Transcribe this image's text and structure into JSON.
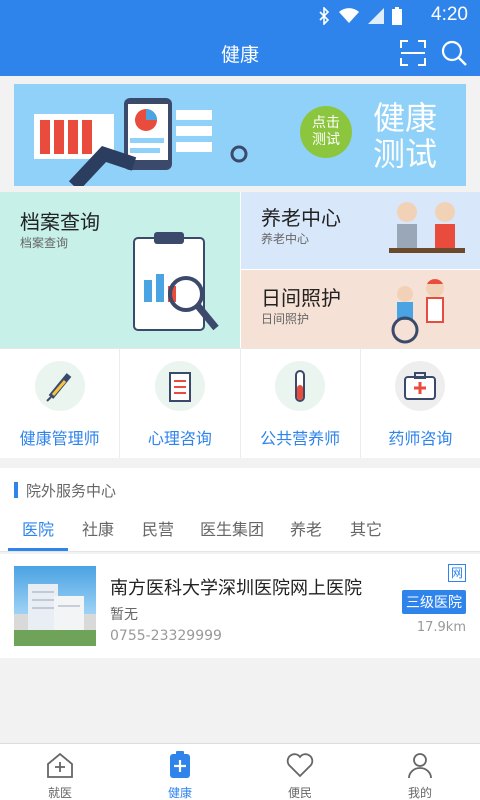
{
  "status_bar": {
    "time": "4:20"
  },
  "header": {
    "title": "健康"
  },
  "banner": {
    "title": "健康测试",
    "button": "点击测试"
  },
  "tiles": {
    "records": {
      "title": "档案查询",
      "subtitle": "档案查询"
    },
    "elderly": {
      "title": "养老中心",
      "subtitle": "养老中心"
    },
    "daycare": {
      "title": "日间照护",
      "subtitle": "日间照护"
    }
  },
  "services": [
    {
      "label": "健康管理师",
      "icon": "syringe-icon"
    },
    {
      "label": "心理咨询",
      "icon": "clipboard-icon"
    },
    {
      "label": "公共营养师",
      "icon": "test-tube-icon"
    },
    {
      "label": "药师咨询",
      "icon": "medical-kit-icon"
    }
  ],
  "section": {
    "title": "院外服务中心",
    "tabs": [
      "医院",
      "社康",
      "民营",
      "医生集团",
      "养老",
      "其它"
    ],
    "active_tab": "医院"
  },
  "hospital": {
    "name": "南方医科大学深圳医院网上医院",
    "note": "暂无",
    "phone": "0755-23329999",
    "web_badge": "网",
    "level": "三级医院",
    "distance": "17.9km"
  },
  "tabbar": [
    {
      "label": "就医",
      "icon": "hospital-icon"
    },
    {
      "label": "健康",
      "icon": "health-plus-icon"
    },
    {
      "label": "便民",
      "icon": "heart-icon"
    },
    {
      "label": "我的",
      "icon": "user-icon"
    }
  ],
  "colors": {
    "primary": "#2f84ec",
    "banner_bg": "#8fd1f8",
    "green": "#8cc63f"
  }
}
